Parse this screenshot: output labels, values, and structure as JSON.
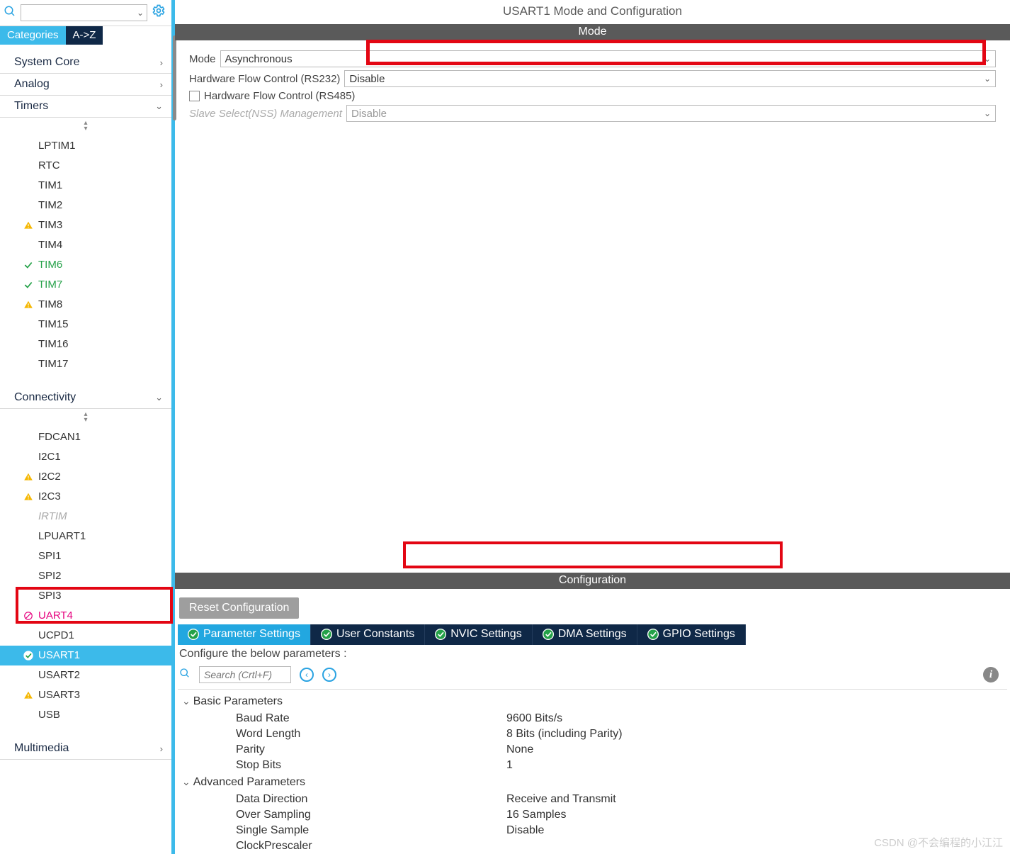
{
  "header": {
    "title": "USART1 Mode and Configuration"
  },
  "sidebar": {
    "tabs": {
      "categories": "Categories",
      "az": "A->Z"
    },
    "sections": {
      "system_core": "System Core",
      "analog": "Analog",
      "timers": "Timers",
      "connectivity": "Connectivity",
      "multimedia": "Multimedia"
    },
    "timers_items": [
      {
        "label": "LPTIM1",
        "icon": ""
      },
      {
        "label": "RTC",
        "icon": ""
      },
      {
        "label": "TIM1",
        "icon": ""
      },
      {
        "label": "TIM2",
        "icon": ""
      },
      {
        "label": "TIM3",
        "icon": "warn"
      },
      {
        "label": "TIM4",
        "icon": ""
      },
      {
        "label": "TIM6",
        "icon": "check"
      },
      {
        "label": "TIM7",
        "icon": "check"
      },
      {
        "label": "TIM8",
        "icon": "warn"
      },
      {
        "label": "TIM15",
        "icon": ""
      },
      {
        "label": "TIM16",
        "icon": ""
      },
      {
        "label": "TIM17",
        "icon": ""
      }
    ],
    "conn_items": [
      {
        "label": "FDCAN1",
        "icon": ""
      },
      {
        "label": "I2C1",
        "icon": ""
      },
      {
        "label": "I2C2",
        "icon": "warn"
      },
      {
        "label": "I2C3",
        "icon": "warn"
      },
      {
        "label": "IRTIM",
        "icon": "",
        "style": "grey"
      },
      {
        "label": "LPUART1",
        "icon": ""
      },
      {
        "label": "SPI1",
        "icon": ""
      },
      {
        "label": "SPI2",
        "icon": ""
      },
      {
        "label": "SPI3",
        "icon": ""
      },
      {
        "label": "UART4",
        "icon": "ban",
        "style": "pink"
      },
      {
        "label": "UCPD1",
        "icon": ""
      },
      {
        "label": "USART1",
        "icon": "checkcircle",
        "style": "selected"
      },
      {
        "label": "USART2",
        "icon": ""
      },
      {
        "label": "USART3",
        "icon": "warn"
      },
      {
        "label": "USB",
        "icon": ""
      }
    ]
  },
  "mode": {
    "section": "Mode",
    "mode_label": "Mode",
    "mode_value": "Asynchronous",
    "hw232_label": "Hardware Flow Control (RS232)",
    "hw232_value": "Disable",
    "hw485_label": "Hardware Flow Control (RS485)",
    "nss_label": "Slave Select(NSS) Management",
    "nss_value": "Disable"
  },
  "config": {
    "section": "Configuration",
    "reset": "Reset Configuration",
    "tabs": [
      "Parameter Settings",
      "User Constants",
      "NVIC Settings",
      "DMA Settings",
      "GPIO Settings"
    ],
    "hint": "Configure the below parameters :",
    "search_placeholder": "Search (Crtl+F)",
    "groups": {
      "basic": "Basic Parameters",
      "advanced": "Advanced Parameters"
    },
    "basic_params": [
      {
        "name": "Baud Rate",
        "value": "9600 Bits/s"
      },
      {
        "name": "Word Length",
        "value": "8 Bits (including Parity)"
      },
      {
        "name": "Parity",
        "value": "None"
      },
      {
        "name": "Stop Bits",
        "value": "1"
      }
    ],
    "adv_params": [
      {
        "name": "Data Direction",
        "value": "Receive and Transmit"
      },
      {
        "name": "Over Sampling",
        "value": "16 Samples"
      },
      {
        "name": "Single Sample",
        "value": "Disable"
      },
      {
        "name": "ClockPrescaler",
        "value": ""
      }
    ]
  },
  "watermark": "CSDN @不会编程的小江江"
}
